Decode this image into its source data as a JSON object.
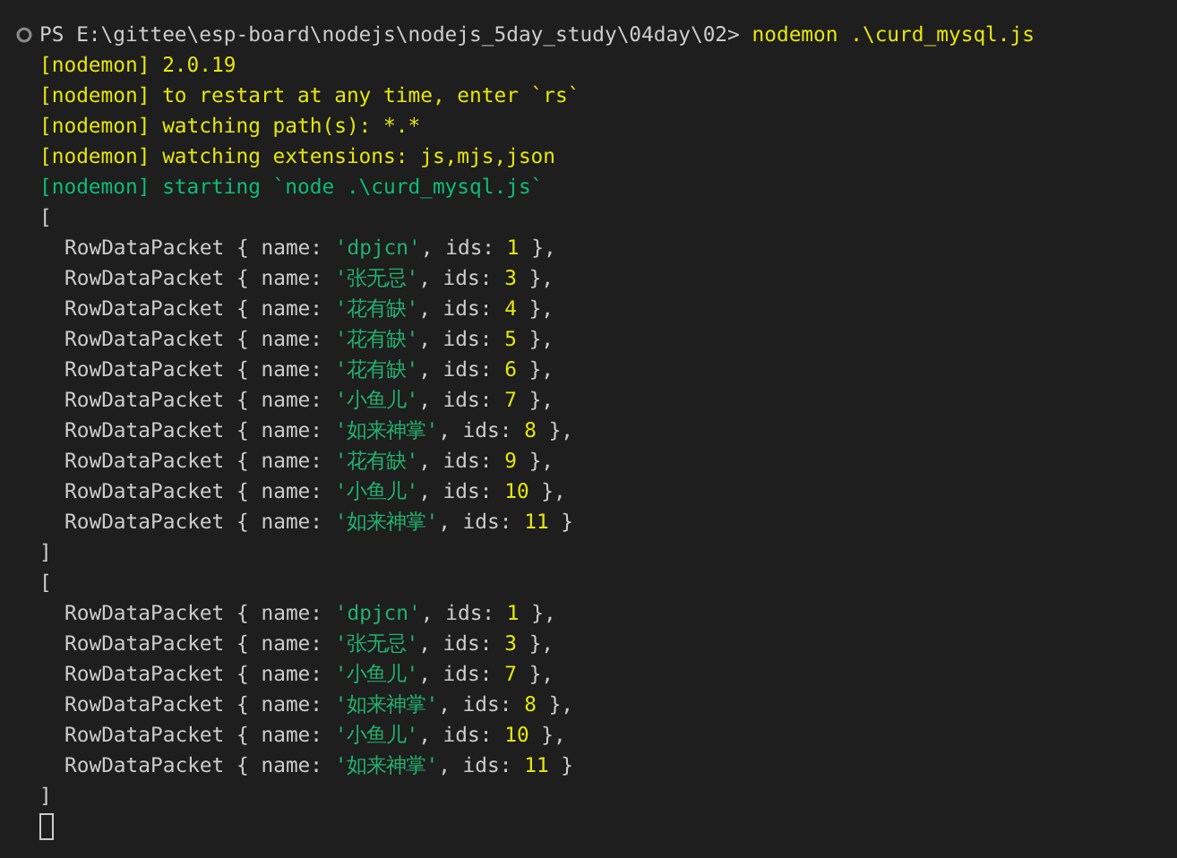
{
  "prompt": {
    "path": "PS E:\\gittee\\esp-board\\nodejs\\nodejs_5day_study\\04day\\02>",
    "command": "nodemon .\\curd_mysql.js"
  },
  "log": [
    {
      "tag": "[nodemon]",
      "text": "2.0.19",
      "kind": "info"
    },
    {
      "tag": "[nodemon]",
      "text": "to restart at any time, enter `rs`",
      "kind": "info"
    },
    {
      "tag": "[nodemon]",
      "text": "watching path(s): *.*",
      "kind": "info"
    },
    {
      "tag": "[nodemon]",
      "text": "watching extensions: js,mjs,json",
      "kind": "info"
    },
    {
      "tag": "[nodemon]",
      "text": "starting `node .\\curd_mysql.js`",
      "kind": "start"
    }
  ],
  "results": [
    {
      "open": "[",
      "close": "]",
      "rows": [
        {
          "type": "RowDataPacket",
          "brace": "{ name:",
          "name": "'dpjcn'",
          "key": ", ids:",
          "ids": "1",
          "end": "},"
        },
        {
          "type": "RowDataPacket",
          "brace": "{ name:",
          "name": "'张无忌'",
          "key": ", ids:",
          "ids": "3",
          "end": "},"
        },
        {
          "type": "RowDataPacket",
          "brace": "{ name:",
          "name": "'花有缺'",
          "key": ", ids:",
          "ids": "4",
          "end": "},"
        },
        {
          "type": "RowDataPacket",
          "brace": "{ name:",
          "name": "'花有缺'",
          "key": ", ids:",
          "ids": "5",
          "end": "},"
        },
        {
          "type": "RowDataPacket",
          "brace": "{ name:",
          "name": "'花有缺'",
          "key": ", ids:",
          "ids": "6",
          "end": "},"
        },
        {
          "type": "RowDataPacket",
          "brace": "{ name:",
          "name": "'小鱼儿'",
          "key": ", ids:",
          "ids": "7",
          "end": "},"
        },
        {
          "type": "RowDataPacket",
          "brace": "{ name:",
          "name": "'如来神掌'",
          "key": ", ids:",
          "ids": "8",
          "end": "},"
        },
        {
          "type": "RowDataPacket",
          "brace": "{ name:",
          "name": "'花有缺'",
          "key": ", ids:",
          "ids": "9",
          "end": "},"
        },
        {
          "type": "RowDataPacket",
          "brace": "{ name:",
          "name": "'小鱼儿'",
          "key": ", ids:",
          "ids": "10",
          "end": "},"
        },
        {
          "type": "RowDataPacket",
          "brace": "{ name:",
          "name": "'如来神掌'",
          "key": ", ids:",
          "ids": "11",
          "end": "}"
        }
      ]
    },
    {
      "open": "[",
      "close": "]",
      "rows": [
        {
          "type": "RowDataPacket",
          "brace": "{ name:",
          "name": "'dpjcn'",
          "key": ", ids:",
          "ids": "1",
          "end": "},"
        },
        {
          "type": "RowDataPacket",
          "brace": "{ name:",
          "name": "'张无忌'",
          "key": ", ids:",
          "ids": "3",
          "end": "},"
        },
        {
          "type": "RowDataPacket",
          "brace": "{ name:",
          "name": "'小鱼儿'",
          "key": ", ids:",
          "ids": "7",
          "end": "},"
        },
        {
          "type": "RowDataPacket",
          "brace": "{ name:",
          "name": "'如来神掌'",
          "key": ", ids:",
          "ids": "8",
          "end": "},"
        },
        {
          "type": "RowDataPacket",
          "brace": "{ name:",
          "name": "'小鱼儿'",
          "key": ", ids:",
          "ids": "10",
          "end": "},"
        },
        {
          "type": "RowDataPacket",
          "brace": "{ name:",
          "name": "'如来神掌'",
          "key": ", ids:",
          "ids": "11",
          "end": "}"
        }
      ]
    }
  ]
}
